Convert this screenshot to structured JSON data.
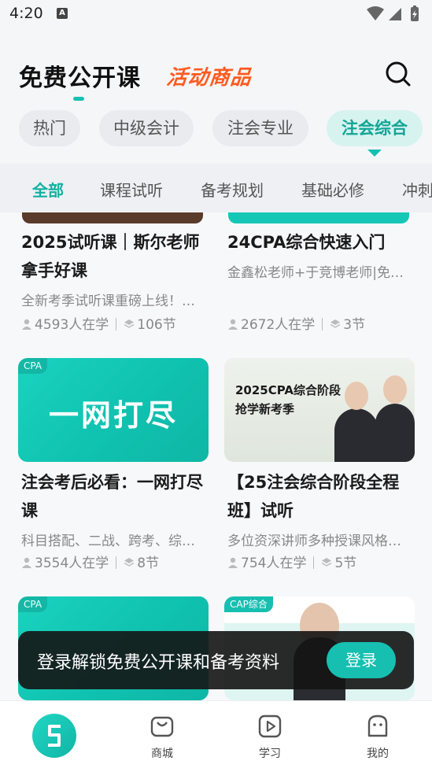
{
  "status_bar": {
    "time": "4:20",
    "notification_icon": "a-icon"
  },
  "header": {
    "title": "免费公开课",
    "promo": "活动商品",
    "search_icon": "search-icon"
  },
  "categories": [
    {
      "label": "热门",
      "active": false
    },
    {
      "label": "中级会计",
      "active": false
    },
    {
      "label": "注会专业",
      "active": false
    },
    {
      "label": "注会综合",
      "active": true
    }
  ],
  "subtabs": [
    {
      "label": "全部",
      "active": true
    },
    {
      "label": "课程试听",
      "active": false
    },
    {
      "label": "备考规划",
      "active": false
    },
    {
      "label": "基础必修",
      "active": false
    },
    {
      "label": "冲刺",
      "active": false
    }
  ],
  "courses": [
    {
      "title": "2025试听课｜斯尔老师拿手好课",
      "desc": "全新考季试听课重磅上线！…",
      "learners": "4593人在学",
      "lessons": "106节"
    },
    {
      "title": "24CPA综合快速入门",
      "desc": "金鑫松老师+于竞博老师|免…",
      "learners": "2672人在学",
      "lessons": "3节"
    },
    {
      "tag": "CPA",
      "thumb_text": "一网打尽",
      "title": "注会考后必看：一网打尽课",
      "desc": "科目搭配、二战、跨考、综…",
      "learners": "3554人在学",
      "lessons": "8节"
    },
    {
      "thumb_line1": "2025CPA综合阶段",
      "thumb_line2": "抢学新考季",
      "title": "【25注会综合阶段全程班】试听",
      "desc": "多位资深讲师多种授课风格…",
      "learners": "754人在学",
      "lessons": "5节"
    },
    {
      "tag": "CPA"
    },
    {
      "tag": "CAP综合"
    }
  ],
  "login_banner": {
    "text": "登录解锁免费公开课和备考资料",
    "button": "登录"
  },
  "bottom_nav": [
    {
      "label": "",
      "icon": "home-logo-icon"
    },
    {
      "label": "商城",
      "icon": "shop-bag-icon"
    },
    {
      "label": "学习",
      "icon": "play-icon"
    },
    {
      "label": "我的",
      "icon": "profile-icon"
    }
  ],
  "colors": {
    "accent": "#16c0b1",
    "promo": "#ff5a1f"
  }
}
